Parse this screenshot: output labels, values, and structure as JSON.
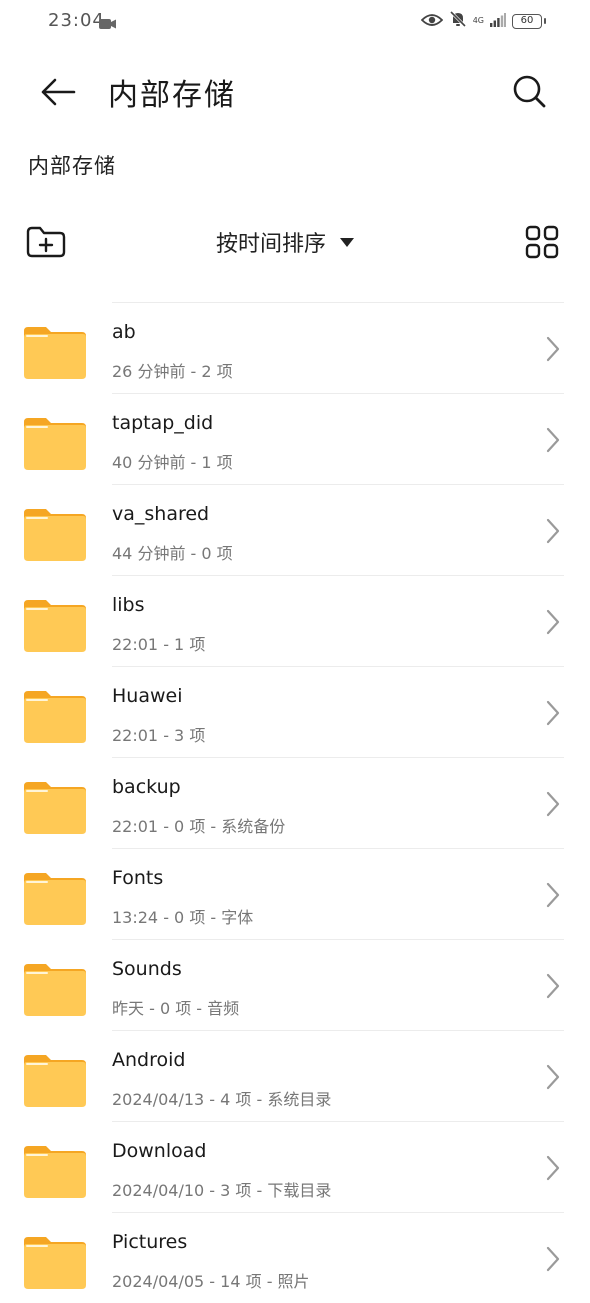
{
  "status": {
    "time": "23:04",
    "network": "4G",
    "battery": "60"
  },
  "header": {
    "title": "内部存储"
  },
  "breadcrumb": "内部存储",
  "toolbar": {
    "sort_label": "按时间排序"
  },
  "colors": {
    "folder_body": "#FFC955",
    "folder_tab": "#F5A623"
  },
  "files": [
    {
      "name": "ab",
      "meta": "26 分钟前 - 2 项"
    },
    {
      "name": "taptap_did",
      "meta": "40 分钟前 - 1 项"
    },
    {
      "name": "va_shared",
      "meta": "44 分钟前 - 0 项"
    },
    {
      "name": "libs",
      "meta": "22:01 - 1 项"
    },
    {
      "name": "Huawei",
      "meta": "22:01 - 3 项"
    },
    {
      "name": "backup",
      "meta": "22:01 - 0 项 - 系统备份"
    },
    {
      "name": "Fonts",
      "meta": "13:24 - 0 项 - 字体"
    },
    {
      "name": "Sounds",
      "meta": "昨天 - 0 项 - 音频"
    },
    {
      "name": "Android",
      "meta": "2024/04/13 - 4 项 - 系统目录"
    },
    {
      "name": "Download",
      "meta": "2024/04/10 - 3 项 - 下载目录"
    },
    {
      "name": "Pictures",
      "meta": "2024/04/05 - 14 项 - 照片"
    }
  ]
}
